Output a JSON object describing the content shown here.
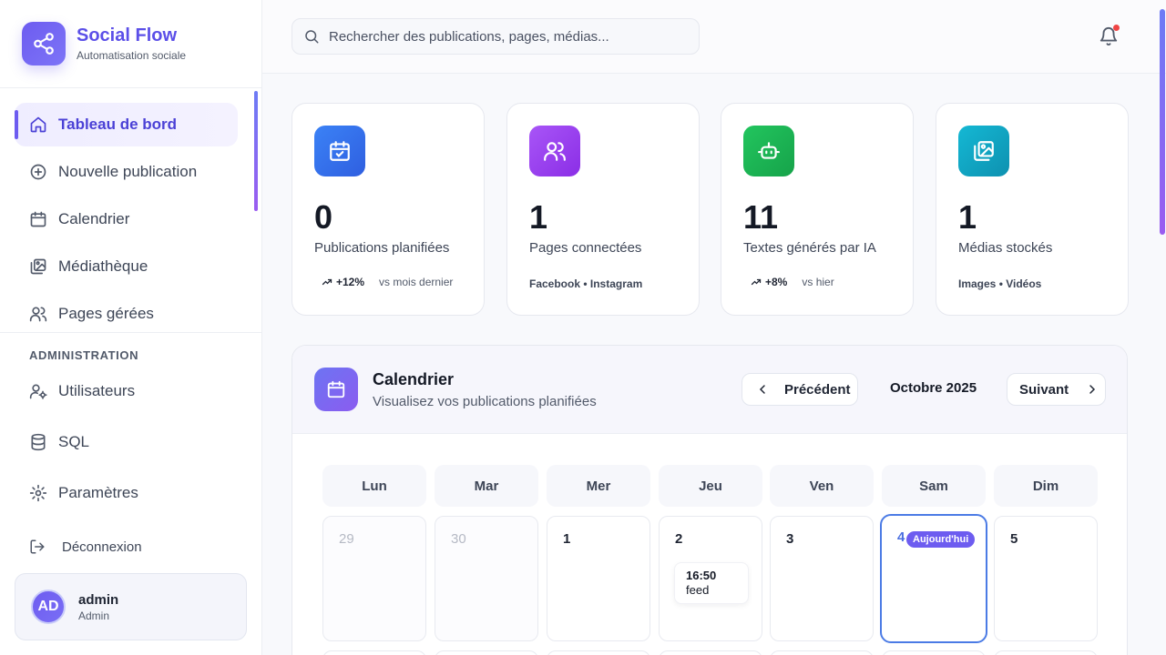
{
  "brand": {
    "name": "Social Flow",
    "tagline": "Automatisation sociale"
  },
  "nav": {
    "items": [
      {
        "label": "Tableau de bord",
        "icon": "home-icon",
        "active": true
      },
      {
        "label": "Nouvelle publication",
        "icon": "plus-circle-icon"
      },
      {
        "label": "Calendrier",
        "icon": "calendar-icon"
      },
      {
        "label": "Médiathèque",
        "icon": "media-library-icon"
      },
      {
        "label": "Pages gérées",
        "icon": "users-icon"
      }
    ]
  },
  "admin": {
    "heading": "ADMINISTRATION",
    "items": [
      {
        "label": "Utilisateurs",
        "icon": "user-cog-icon"
      },
      {
        "label": "SQL",
        "icon": "database-icon"
      },
      {
        "label": "Paramètres",
        "icon": "gear-icon"
      }
    ],
    "logout": "Déconnexion"
  },
  "user": {
    "initials": "AD",
    "name": "admin",
    "role": "Admin"
  },
  "search": {
    "placeholder": "Rechercher des publications, pages, médias..."
  },
  "stats": [
    {
      "value": "0",
      "label": "Publications planifiées",
      "trend": "+12%",
      "trend_note": "vs mois dernier",
      "color": "#3b6ff0",
      "icon": "calendar-check-icon"
    },
    {
      "value": "1",
      "label": "Pages connectées",
      "sub": "Facebook • Instagram",
      "color": "#9b3ff0",
      "icon": "users-icon"
    },
    {
      "value": "11",
      "label": "Textes générés par IA",
      "trend": "+8%",
      "trend_note": "vs hier",
      "color": "#1faa4c",
      "icon": "robot-icon"
    },
    {
      "value": "1",
      "label": "Médias stockés",
      "sub": "Images • Vidéos",
      "color": "#0fa3c4",
      "icon": "images-icon"
    }
  ],
  "calendar": {
    "title": "Calendrier",
    "subtitle": "Visualisez vos publications planifiées",
    "prev_label": "Précédent",
    "next_label": "Suivant",
    "month": "Octobre 2025",
    "weekdays": [
      "Lun",
      "Mar",
      "Mer",
      "Jeu",
      "Ven",
      "Sam",
      "Dim"
    ],
    "days": [
      {
        "n": "29",
        "muted": true
      },
      {
        "n": "30",
        "muted": true
      },
      {
        "n": "1"
      },
      {
        "n": "2",
        "event": {
          "time": "16:50",
          "type": "feed"
        }
      },
      {
        "n": "3"
      },
      {
        "n": "4",
        "today": true,
        "badge": "Aujourd'hui"
      },
      {
        "n": "5"
      }
    ]
  }
}
